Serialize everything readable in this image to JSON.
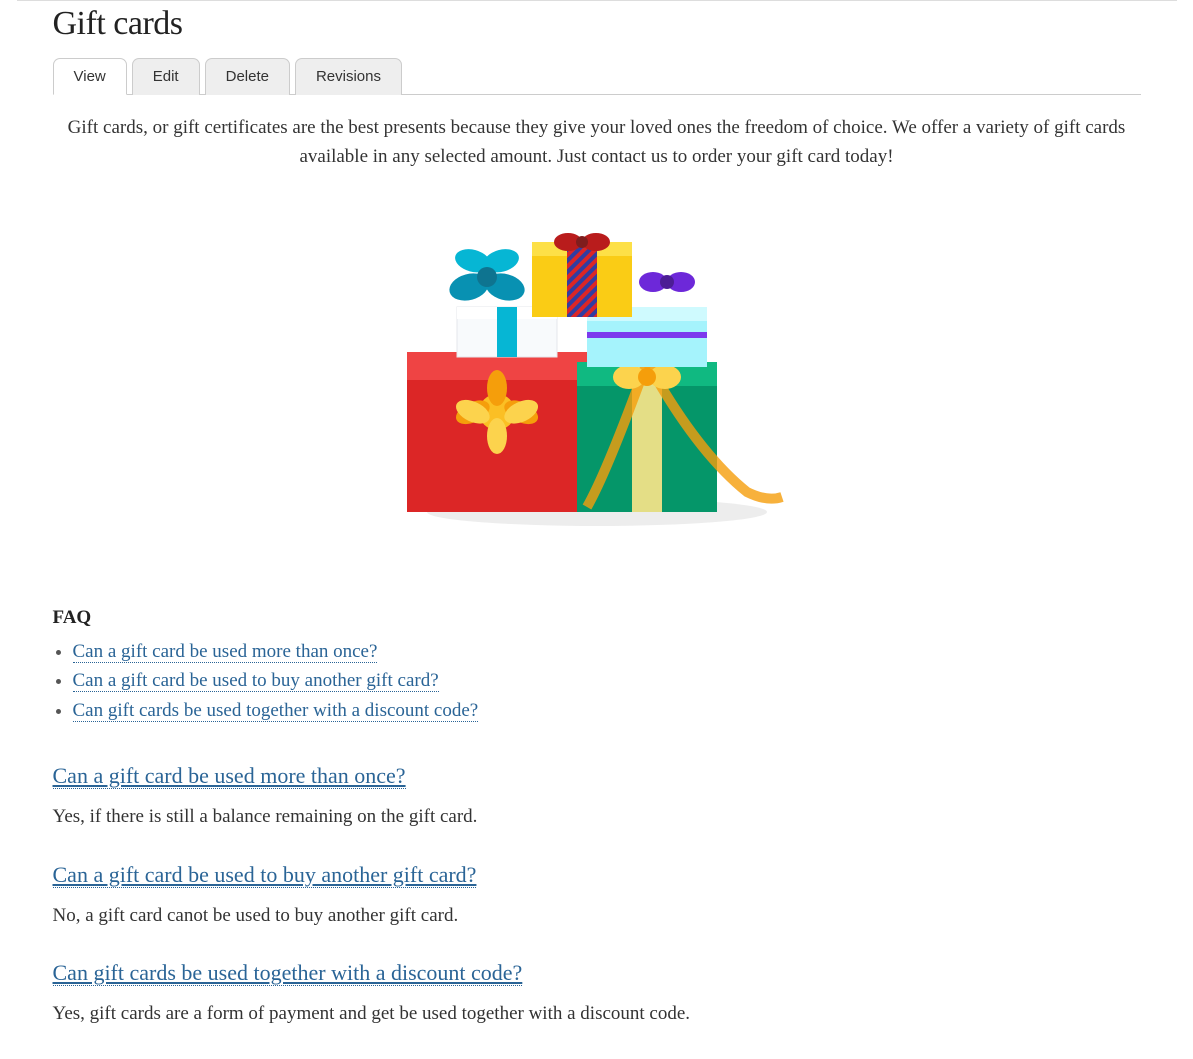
{
  "page": {
    "title": "Gift cards"
  },
  "tabs": [
    {
      "label": "View",
      "active": true
    },
    {
      "label": "Edit",
      "active": false
    },
    {
      "label": "Delete",
      "active": false
    },
    {
      "label": "Revisions",
      "active": false
    }
  ],
  "intro": "Gift cards, or gift certificates are the best presents because they give your loved ones the freedom of choice. We offer a variety of gift cards available in any selected amount.  Just contact us to order your gift card today!",
  "image_alt": "Stack of wrapped gift boxes with ribbons and bows",
  "faq": {
    "heading": "FAQ",
    "items": [
      {
        "question": "Can a gift card be used more than once?",
        "answer": "Yes, if there is still a balance remaining on the gift card."
      },
      {
        "question": "Can a gift card be used to buy another gift card?",
        "answer": "No, a gift card canot be used to buy another gift card."
      },
      {
        "question": "Can gift cards be used together with a discount code?",
        "answer": "Yes, gift cards are a form of payment and get be used together with a discount code."
      }
    ]
  }
}
